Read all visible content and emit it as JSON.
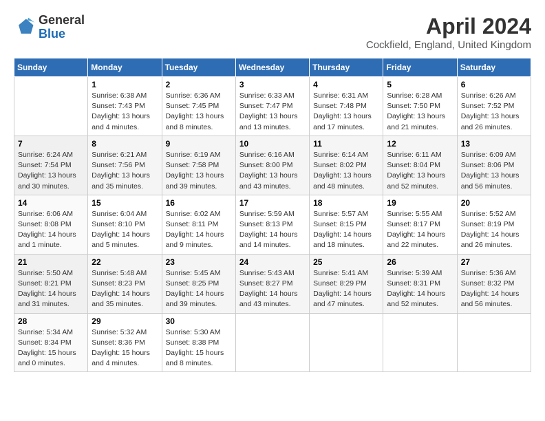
{
  "logo": {
    "general": "General",
    "blue": "Blue"
  },
  "title": "April 2024",
  "location": "Cockfield, England, United Kingdom",
  "days_of_week": [
    "Sunday",
    "Monday",
    "Tuesday",
    "Wednesday",
    "Thursday",
    "Friday",
    "Saturday"
  ],
  "weeks": [
    [
      {
        "num": "",
        "info": ""
      },
      {
        "num": "1",
        "info": "Sunrise: 6:38 AM\nSunset: 7:43 PM\nDaylight: 13 hours\nand 4 minutes."
      },
      {
        "num": "2",
        "info": "Sunrise: 6:36 AM\nSunset: 7:45 PM\nDaylight: 13 hours\nand 8 minutes."
      },
      {
        "num": "3",
        "info": "Sunrise: 6:33 AM\nSunset: 7:47 PM\nDaylight: 13 hours\nand 13 minutes."
      },
      {
        "num": "4",
        "info": "Sunrise: 6:31 AM\nSunset: 7:48 PM\nDaylight: 13 hours\nand 17 minutes."
      },
      {
        "num": "5",
        "info": "Sunrise: 6:28 AM\nSunset: 7:50 PM\nDaylight: 13 hours\nand 21 minutes."
      },
      {
        "num": "6",
        "info": "Sunrise: 6:26 AM\nSunset: 7:52 PM\nDaylight: 13 hours\nand 26 minutes."
      }
    ],
    [
      {
        "num": "7",
        "info": "Sunrise: 6:24 AM\nSunset: 7:54 PM\nDaylight: 13 hours\nand 30 minutes."
      },
      {
        "num": "8",
        "info": "Sunrise: 6:21 AM\nSunset: 7:56 PM\nDaylight: 13 hours\nand 35 minutes."
      },
      {
        "num": "9",
        "info": "Sunrise: 6:19 AM\nSunset: 7:58 PM\nDaylight: 13 hours\nand 39 minutes."
      },
      {
        "num": "10",
        "info": "Sunrise: 6:16 AM\nSunset: 8:00 PM\nDaylight: 13 hours\nand 43 minutes."
      },
      {
        "num": "11",
        "info": "Sunrise: 6:14 AM\nSunset: 8:02 PM\nDaylight: 13 hours\nand 48 minutes."
      },
      {
        "num": "12",
        "info": "Sunrise: 6:11 AM\nSunset: 8:04 PM\nDaylight: 13 hours\nand 52 minutes."
      },
      {
        "num": "13",
        "info": "Sunrise: 6:09 AM\nSunset: 8:06 PM\nDaylight: 13 hours\nand 56 minutes."
      }
    ],
    [
      {
        "num": "14",
        "info": "Sunrise: 6:06 AM\nSunset: 8:08 PM\nDaylight: 14 hours\nand 1 minute."
      },
      {
        "num": "15",
        "info": "Sunrise: 6:04 AM\nSunset: 8:10 PM\nDaylight: 14 hours\nand 5 minutes."
      },
      {
        "num": "16",
        "info": "Sunrise: 6:02 AM\nSunset: 8:11 PM\nDaylight: 14 hours\nand 9 minutes."
      },
      {
        "num": "17",
        "info": "Sunrise: 5:59 AM\nSunset: 8:13 PM\nDaylight: 14 hours\nand 14 minutes."
      },
      {
        "num": "18",
        "info": "Sunrise: 5:57 AM\nSunset: 8:15 PM\nDaylight: 14 hours\nand 18 minutes."
      },
      {
        "num": "19",
        "info": "Sunrise: 5:55 AM\nSunset: 8:17 PM\nDaylight: 14 hours\nand 22 minutes."
      },
      {
        "num": "20",
        "info": "Sunrise: 5:52 AM\nSunset: 8:19 PM\nDaylight: 14 hours\nand 26 minutes."
      }
    ],
    [
      {
        "num": "21",
        "info": "Sunrise: 5:50 AM\nSunset: 8:21 PM\nDaylight: 14 hours\nand 31 minutes."
      },
      {
        "num": "22",
        "info": "Sunrise: 5:48 AM\nSunset: 8:23 PM\nDaylight: 14 hours\nand 35 minutes."
      },
      {
        "num": "23",
        "info": "Sunrise: 5:45 AM\nSunset: 8:25 PM\nDaylight: 14 hours\nand 39 minutes."
      },
      {
        "num": "24",
        "info": "Sunrise: 5:43 AM\nSunset: 8:27 PM\nDaylight: 14 hours\nand 43 minutes."
      },
      {
        "num": "25",
        "info": "Sunrise: 5:41 AM\nSunset: 8:29 PM\nDaylight: 14 hours\nand 47 minutes."
      },
      {
        "num": "26",
        "info": "Sunrise: 5:39 AM\nSunset: 8:31 PM\nDaylight: 14 hours\nand 52 minutes."
      },
      {
        "num": "27",
        "info": "Sunrise: 5:36 AM\nSunset: 8:32 PM\nDaylight: 14 hours\nand 56 minutes."
      }
    ],
    [
      {
        "num": "28",
        "info": "Sunrise: 5:34 AM\nSunset: 8:34 PM\nDaylight: 15 hours\nand 0 minutes."
      },
      {
        "num": "29",
        "info": "Sunrise: 5:32 AM\nSunset: 8:36 PM\nDaylight: 15 hours\nand 4 minutes."
      },
      {
        "num": "30",
        "info": "Sunrise: 5:30 AM\nSunset: 8:38 PM\nDaylight: 15 hours\nand 8 minutes."
      },
      {
        "num": "",
        "info": ""
      },
      {
        "num": "",
        "info": ""
      },
      {
        "num": "",
        "info": ""
      },
      {
        "num": "",
        "info": ""
      }
    ]
  ]
}
